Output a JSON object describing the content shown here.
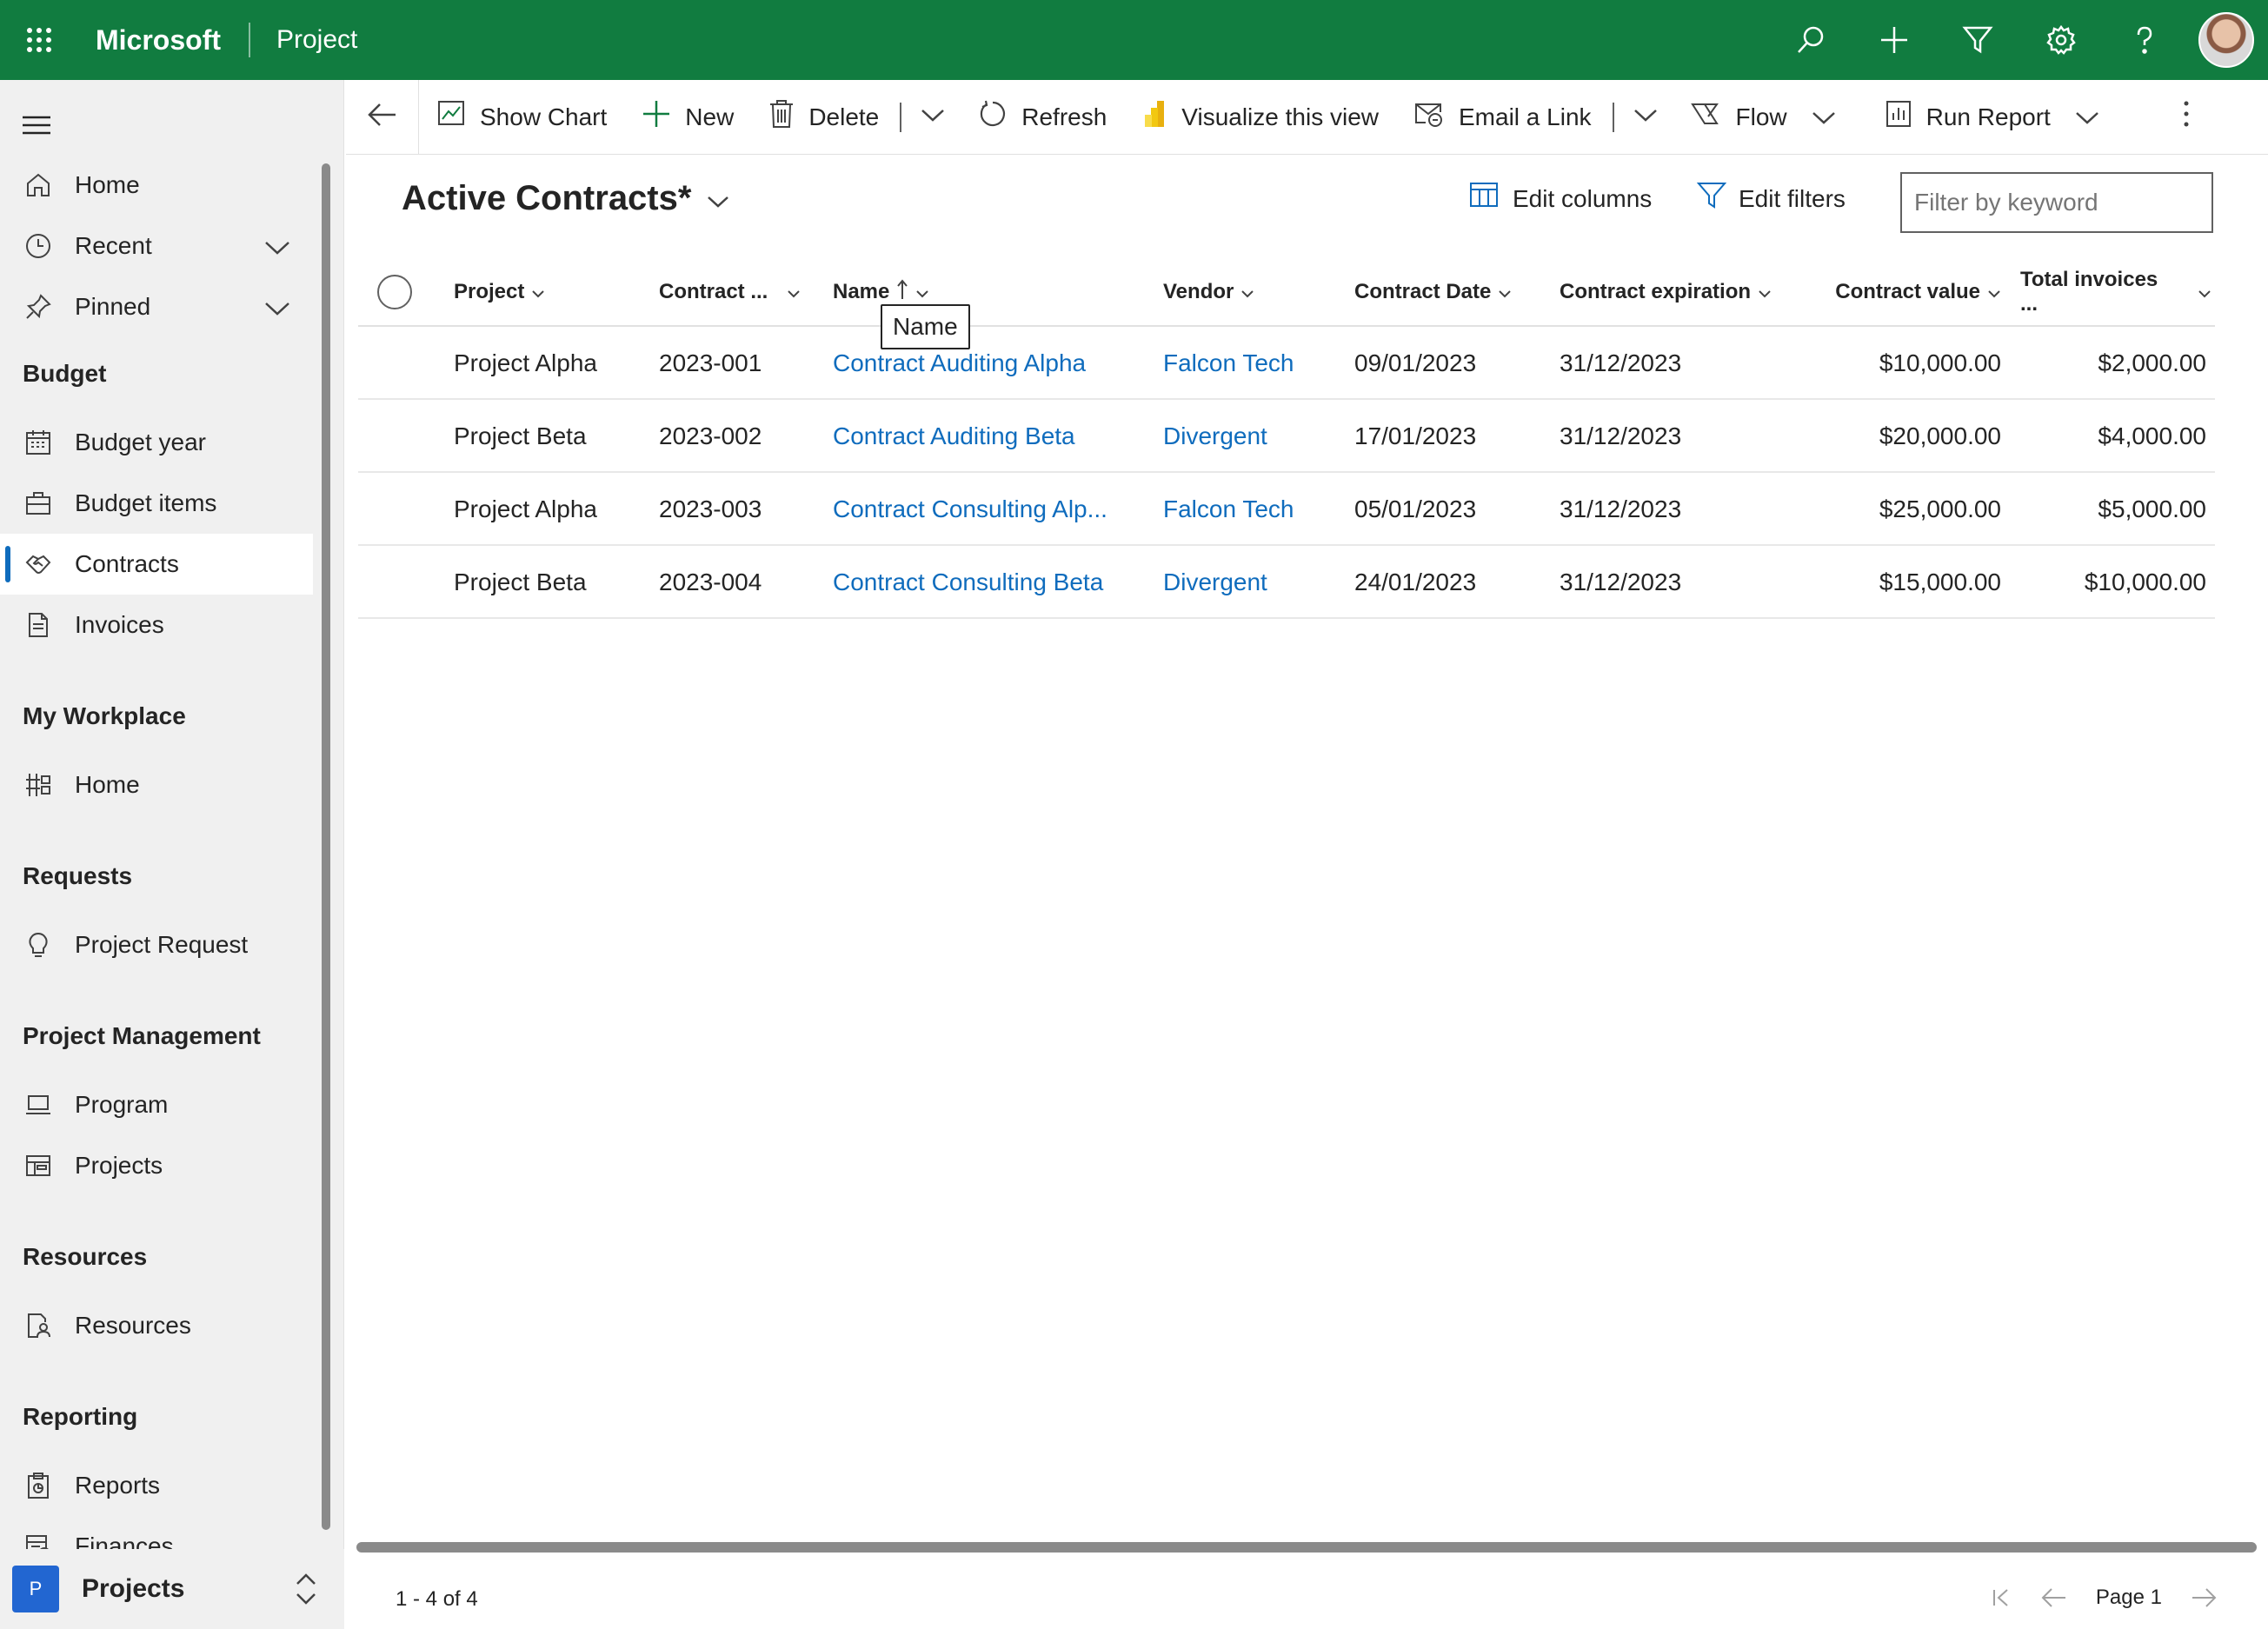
{
  "topbar": {
    "brand": "Microsoft",
    "app_name": "Project",
    "bg_color": "#117c40",
    "icons": [
      "waffle-icon",
      "search-icon",
      "add-icon",
      "filter-icon",
      "settings-icon",
      "help-icon",
      "avatar"
    ]
  },
  "sidebar": {
    "items_top": [
      {
        "label": "Home",
        "icon": "home-icon"
      },
      {
        "label": "Recent",
        "icon": "clock-icon",
        "expandable": true
      },
      {
        "label": "Pinned",
        "icon": "pin-icon",
        "expandable": true
      }
    ],
    "groups": [
      {
        "title": "Budget",
        "items": [
          {
            "label": "Budget year",
            "icon": "calendar-icon"
          },
          {
            "label": "Budget items",
            "icon": "briefcase-icon"
          },
          {
            "label": "Contracts",
            "icon": "handshake-icon",
            "selected": true
          },
          {
            "label": "Invoices",
            "icon": "document-icon"
          }
        ]
      },
      {
        "title": "My Workplace",
        "items": [
          {
            "label": "Home",
            "icon": "dashboard-icon"
          }
        ]
      },
      {
        "title": "Requests",
        "items": [
          {
            "label": "Project Request",
            "icon": "lightbulb-icon"
          }
        ]
      },
      {
        "title": "Project Management",
        "items": [
          {
            "label": "Program",
            "icon": "laptop-icon"
          },
          {
            "label": "Projects",
            "icon": "projects-icon"
          }
        ]
      },
      {
        "title": "Resources",
        "items": [
          {
            "label": "Resources",
            "icon": "person-doc-icon"
          }
        ]
      },
      {
        "title": "Reporting",
        "items": [
          {
            "label": "Reports",
            "icon": "report-icon"
          },
          {
            "label": "Finances",
            "icon": "finance-icon"
          }
        ]
      }
    ],
    "area": {
      "badge": "P",
      "label": "Projects"
    }
  },
  "commands": {
    "show_chart": "Show Chart",
    "new": "New",
    "delete": "Delete",
    "refresh": "Refresh",
    "visualize": "Visualize this view",
    "email_link": "Email a Link",
    "flow": "Flow",
    "run_report": "Run Report"
  },
  "view": {
    "title": "Active Contracts*",
    "edit_columns": "Edit columns",
    "edit_filters": "Edit filters",
    "filter_placeholder": "Filter by keyword"
  },
  "grid": {
    "columns": [
      "Project",
      "Contract ...",
      "Name",
      "Vendor",
      "Contract Date",
      "Contract expiration",
      "Contract value",
      "Total invoices ..."
    ],
    "sorted_column": "Name",
    "tooltip": "Name",
    "rows": [
      [
        "Project Alpha",
        "2023-001",
        "Contract Auditing Alpha",
        "Falcon Tech",
        "09/01/2023",
        "31/12/2023",
        "$10,000.00",
        "$2,000.00"
      ],
      [
        "Project Beta",
        "2023-002",
        "Contract Auditing Beta",
        "Divergent",
        "17/01/2023",
        "31/12/2023",
        "$20,000.00",
        "$4,000.00"
      ],
      [
        "Project Alpha",
        "2023-003",
        "Contract Consulting Alp...",
        "Falcon Tech",
        "05/01/2023",
        "31/12/2023",
        "$25,000.00",
        "$5,000.00"
      ],
      [
        "Project Beta",
        "2023-004",
        "Contract Consulting Beta",
        "Divergent",
        "24/01/2023",
        "31/12/2023",
        "$15,000.00",
        "$10,000.00"
      ]
    ]
  },
  "footer": {
    "count": "1 - 4 of 4",
    "page": "Page 1"
  }
}
